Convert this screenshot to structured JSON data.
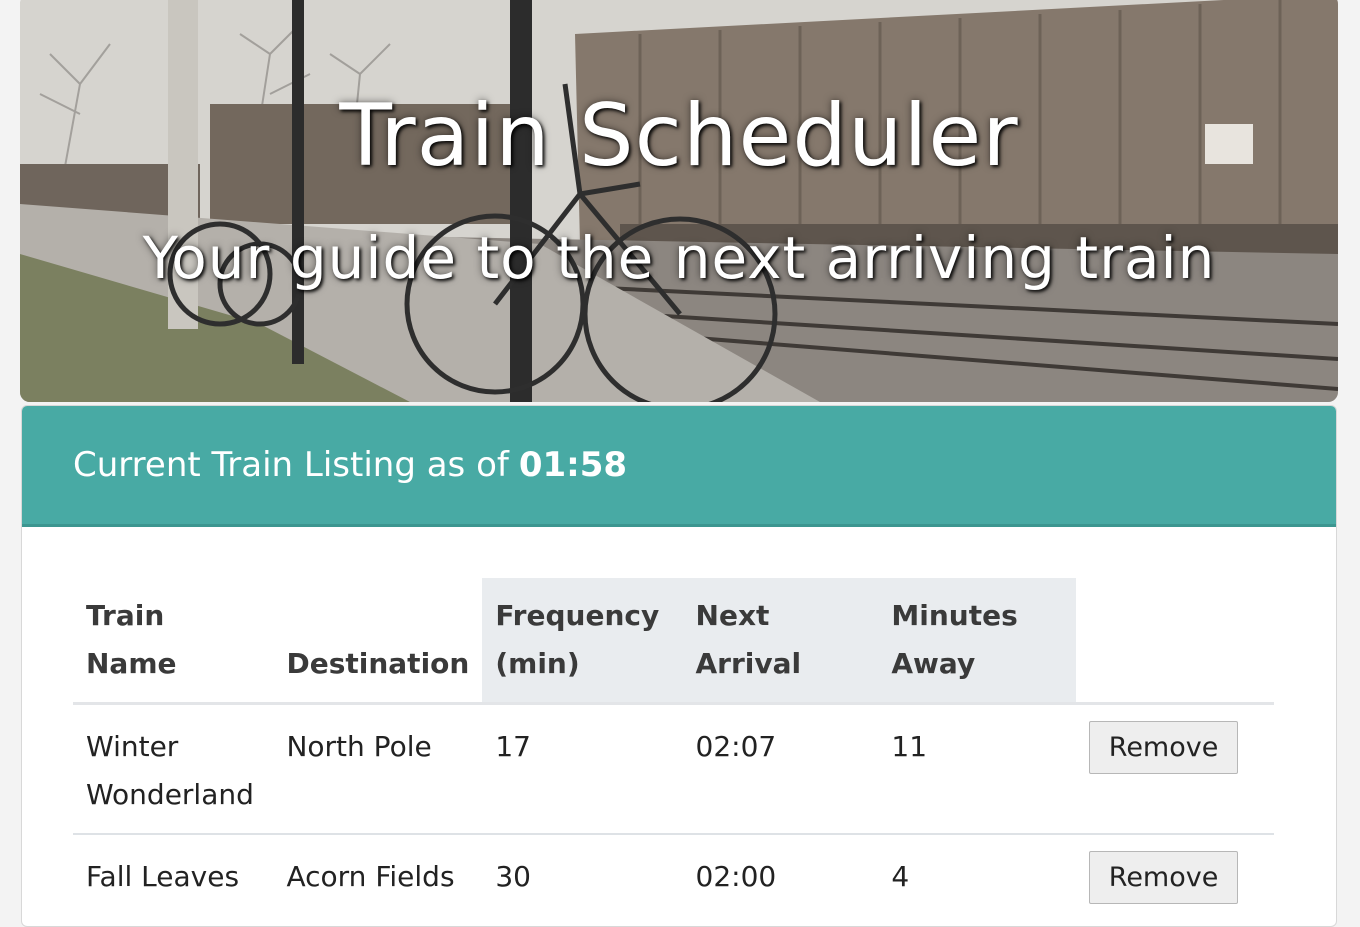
{
  "hero": {
    "title": "Train Scheduler",
    "subtitle": "Your guide to the next arriving train"
  },
  "listing": {
    "header_prefix": "Current Train Listing as of",
    "current_time": "01:58",
    "columns": [
      "Train Name",
      "Destination",
      "Frequency (min)",
      "Next Arrival",
      "Minutes Away"
    ],
    "rows": [
      {
        "name": "Winter Wonderland",
        "destination": "North Pole",
        "frequency": "17",
        "next_arrival": "02:07",
        "minutes_away": "11",
        "action": "Remove"
      },
      {
        "name": "Fall Leaves",
        "destination": "Acorn Fields",
        "frequency": "30",
        "next_arrival": "02:00",
        "minutes_away": "4",
        "action": "Remove"
      }
    ]
  },
  "colors": {
    "header_bg": "#48aaa4",
    "table_header_bg": "#e9ecef"
  }
}
